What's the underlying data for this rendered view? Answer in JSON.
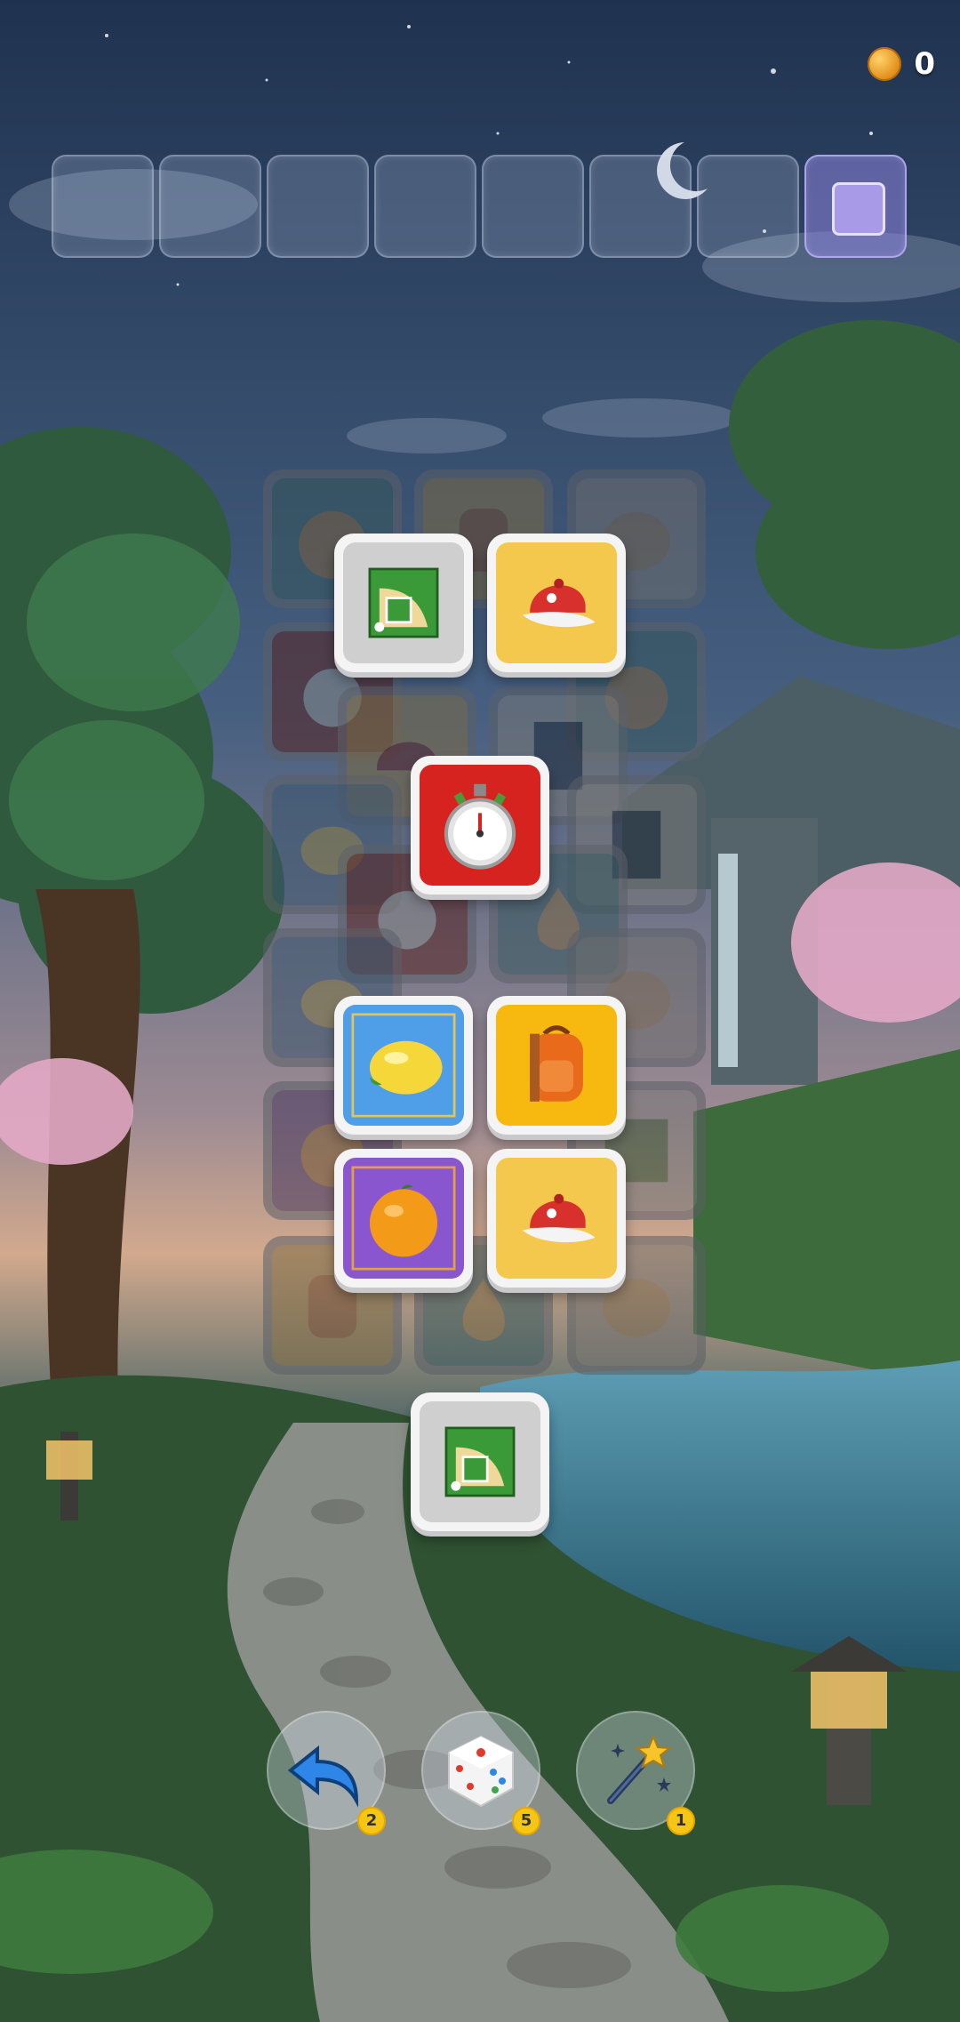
{
  "hud": {
    "coin_count": "0",
    "coin_icon": "gold-coin-icon"
  },
  "tray": {
    "slot_count": 8,
    "active_slot": 8
  },
  "board": {
    "top_tiles": [
      {
        "id": "baseball-field",
        "item": "baseball-field-icon",
        "state": "free"
      },
      {
        "id": "red-cap",
        "item": "red-cap-icon",
        "state": "free"
      },
      {
        "id": "stopwatch",
        "item": "stopwatch-icon",
        "state": "free"
      },
      {
        "id": "lemon",
        "item": "lemon-icon",
        "state": "free"
      },
      {
        "id": "backpack",
        "item": "orange-backpack-icon",
        "state": "free"
      },
      {
        "id": "orange",
        "item": "orange-fruit-icon",
        "state": "free"
      },
      {
        "id": "red-cap-2",
        "item": "red-cap-icon",
        "state": "free"
      },
      {
        "id": "baseball-field-2",
        "item": "baseball-field-icon",
        "state": "free"
      }
    ],
    "covered_tiles": [
      "pumpkin-icon",
      "backpack-icon",
      "baseball-glove-icon",
      "stopwatch-icon",
      "pumpkin-icon",
      "red-cap-icon",
      "notebook-icon",
      "lemon-icon",
      "notebook-icon",
      "stopwatch-icon",
      "pear-icon",
      "lemon-icon",
      "baseball-glove-icon",
      "orange-fruit-icon",
      "baseball-field-icon",
      "backpack-icon",
      "pear-icon",
      "baseball-glove-icon"
    ]
  },
  "tools": [
    {
      "name": "undo",
      "icon": "undo-arrow-icon",
      "count": "2"
    },
    {
      "name": "shuffle",
      "icon": "dice-icon",
      "count": "5"
    },
    {
      "name": "magic",
      "icon": "magic-wand-icon",
      "count": "1"
    }
  ],
  "colors": {
    "sky_top": "#263a58",
    "sky_mid": "#4d6687",
    "horizon": "#c79c86",
    "forest": "#2d5a3a",
    "water": "#2f6f85"
  }
}
